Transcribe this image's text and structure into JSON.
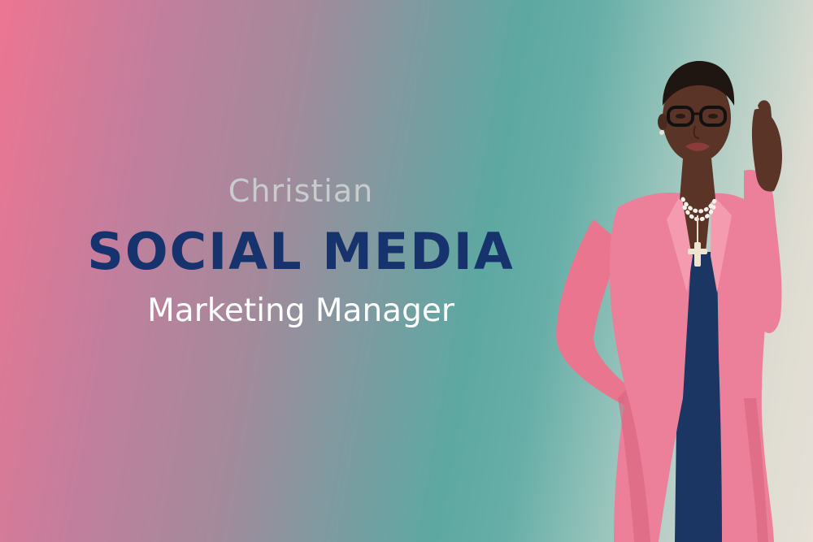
{
  "banner": {
    "kicker": "Christian",
    "headline": "SOCIAL MEDIA",
    "subheadline": "Marketing Manager"
  },
  "colors": {
    "gradient_left": "#ec7592",
    "gradient_mid": "#5ea8a2",
    "gradient_right": "#e6e0d7",
    "headline": "#17336d",
    "kicker": "#c9cccd",
    "subheadline": "#ffffff",
    "blazer": "#ec7f9a",
    "top": "#1b3663"
  },
  "illustration": {
    "icon": "woman-in-pink-blazer-illustration"
  }
}
